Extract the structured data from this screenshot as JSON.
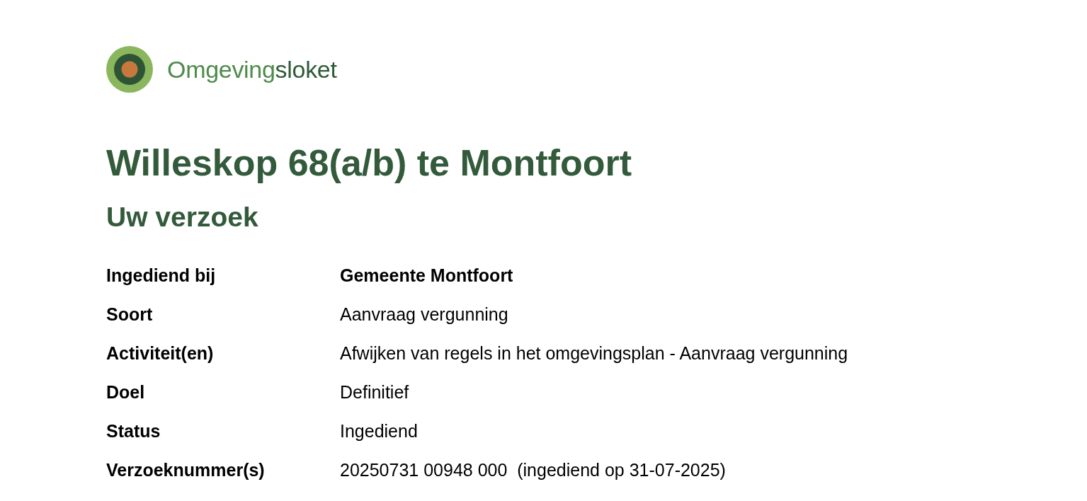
{
  "logo": {
    "wordmark": [
      {
        "text": "Omgeving",
        "kind": "light"
      },
      {
        "text": "sloket",
        "kind": "dark"
      }
    ]
  },
  "title": "Willeskop 68(a/b) te Montfoort",
  "section": {
    "heading": "Uw verzoek",
    "rows": [
      {
        "label": "Ingediend bij",
        "value": "Gemeente Montfoort",
        "bold": true
      },
      {
        "label": "Soort",
        "value": "Aanvraag vergunning",
        "bold": false
      },
      {
        "label": "Activiteit(en)",
        "value": "Afwijken van regels in het omgevingsplan - Aanvraag vergunning",
        "bold": false
      },
      {
        "label": "Doel",
        "value": "Definitief",
        "bold": false
      },
      {
        "label": "Status",
        "value": "Ingediend",
        "bold": false
      },
      {
        "label": "Verzoeknummer(s)",
        "value": "20250731 00948 000  (ingediend op 31-07-2025)",
        "bold": false
      }
    ]
  }
}
